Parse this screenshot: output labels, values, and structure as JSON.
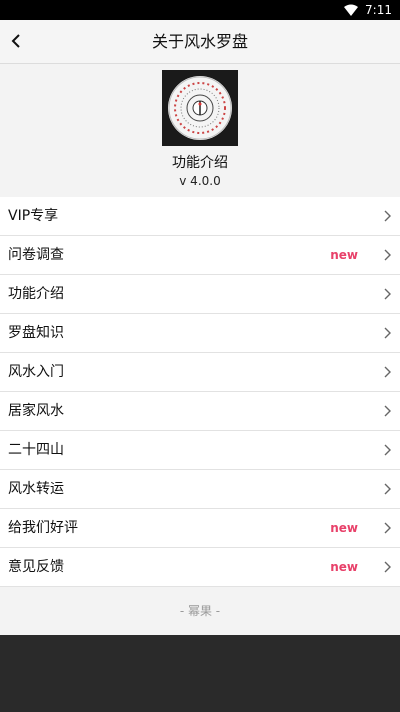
{
  "status_bar": {
    "time": "7:11",
    "wifi_icon": "wifi-icon"
  },
  "app_bar": {
    "title": "关于风水罗盘",
    "back_icon": "back-arrow-icon"
  },
  "about": {
    "app_name": "功能介绍",
    "version": "v 4.0.0",
    "logo_icon": "compass-logo"
  },
  "menu": {
    "items": [
      {
        "label": "VIP专享",
        "badge": ""
      },
      {
        "label": "问卷调查",
        "badge": "new"
      },
      {
        "label": "功能介绍",
        "badge": ""
      },
      {
        "label": "罗盘知识",
        "badge": ""
      },
      {
        "label": "风水入门",
        "badge": ""
      },
      {
        "label": "居家风水",
        "badge": ""
      },
      {
        "label": "二十四山",
        "badge": ""
      },
      {
        "label": "风水转运",
        "badge": ""
      },
      {
        "label": "给我们好评",
        "badge": "new"
      },
      {
        "label": "意见反馈",
        "badge": "new"
      }
    ]
  },
  "footer": {
    "brand": "- 幂果 -"
  },
  "colors": {
    "badge": "#e8416a",
    "status_bar": "#000000"
  }
}
